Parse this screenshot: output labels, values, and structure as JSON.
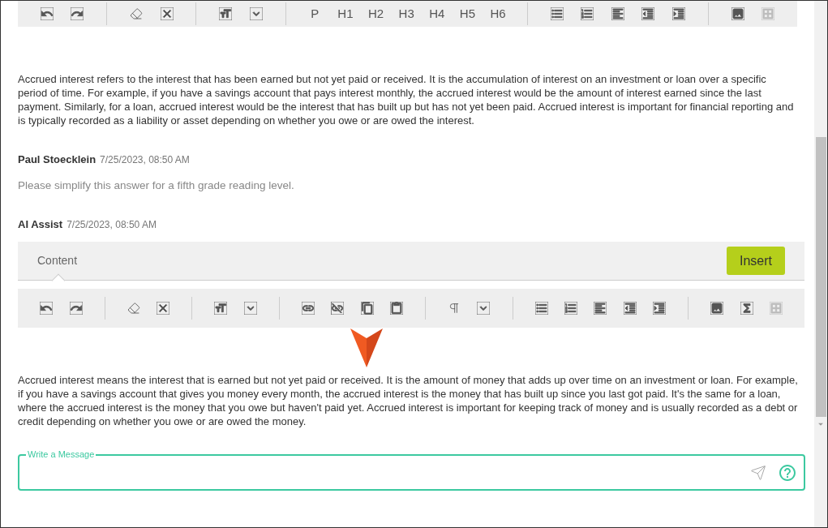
{
  "top_toolbar": {
    "heading_buttons": [
      "P",
      "H1",
      "H2",
      "H3",
      "H4",
      "H5",
      "H6"
    ]
  },
  "messages": [
    {
      "kind": "answer",
      "text": "Accrued interest refers to the interest that has been earned but not yet paid or received. It is the accumulation of interest on an investment or loan over a specific period of time. For example, if you have a savings account that pays interest monthly, the accrued interest would be the amount of interest earned since the last payment. Similarly, for a loan, accrued interest would be the interest that has built up but has not yet been paid. Accrued interest is important for financial reporting and is typically recorded as a liability or asset depending on whether you owe or are owed the interest."
    },
    {
      "kind": "user",
      "author": "Paul Stoecklein",
      "time": "7/25/2023, 08:50 AM",
      "text": "Please simplify this answer for a fifth grade reading level."
    },
    {
      "kind": "editor",
      "author": "AI Assist",
      "time": "7/25/2023, 08:50 AM",
      "tabs": [
        {
          "label": "Content",
          "selected": true
        }
      ],
      "insert_button": "Insert",
      "text": "Accrued interest means the interest that is earned but not yet paid or received. It is the amount of money that adds up over time on an investment or loan. For example, if you have a savings account that gives you money every month, the accrued interest is the money that has built up since you last got paid. It's the same for a loan, where the accrued interest is the money that you owe but haven't paid yet. Accrued interest is important for keeping track of money and is usually recorded as a debt or credit depending on whether you owe or are owed the money."
    }
  ],
  "composer": {
    "label": "Write a Message"
  }
}
